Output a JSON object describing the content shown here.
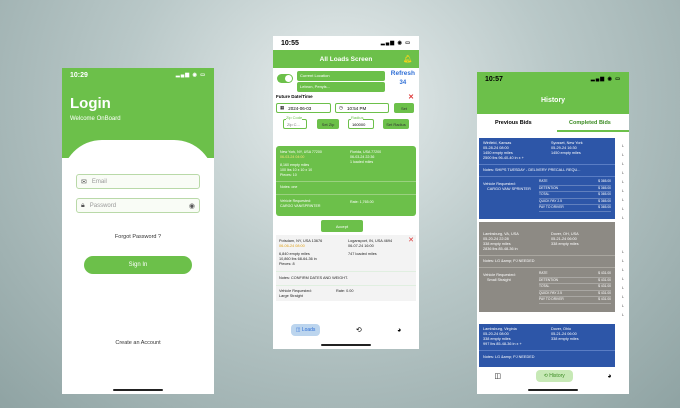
{
  "login": {
    "time": "10:29",
    "title": "Login",
    "subtitle": "Welcome OnBoard",
    "email_placeholder": "Email",
    "password_placeholder": "Password",
    "forgot": "Forgot Password ?",
    "signin": "Sign In",
    "create": "Create an Account"
  },
  "loads": {
    "time": "10:55",
    "title": "All Loads Screen",
    "current_location": "Current Location",
    "current_location_value": "Lebron, Penyls...",
    "refresh": "Refresh",
    "count": "34",
    "future_label": "Future Date/Time",
    "date": "2024-06-03",
    "time_value": "10:54 PM",
    "set": "Set",
    "zip_label": "Zip Code",
    "zip_value": "Zip C...",
    "set_zip": "Set Zip",
    "radius_label": "Radius",
    "radius_value": "160000",
    "set_radius": "Set Radius",
    "card1": {
      "origin": "New York, NY, USA 77200",
      "origin_date": "06-03-24 04:00",
      "dest": "Florida, USA 77200",
      "dest_date": "06-03-24 22:36",
      "empty": "8,160 empty miles",
      "weight": "100 lbs 10 x 10 x 10",
      "pieces": "Pieces: 10",
      "dest_loaded": "1 loaded miles",
      "notes": "Notes: one",
      "vehicle_label": "Vehicle Requested:",
      "vehicle": "CARGO VAN/SPRINTER",
      "rate": "Rate: 1,765.00"
    },
    "accept": "Accept",
    "card2": {
      "origin": "Potsdam, NY, USA 13676",
      "origin_date": "06-06-24 08:00",
      "dest": "Logansport, IN, USA 4694",
      "dest_date": "06-07-24 16:00",
      "empty": "6,840 empty miles",
      "dest_loaded": "747 loaded miles",
      "weight": "10,860 lbs 68-64-36 in",
      "pieces": "Pieces: 8",
      "notes": "Notes: CONFIRM DATES AND WEIGHT.",
      "vehicle_label": "Vehicle Requested:",
      "vehicle": "Large Straight",
      "rate": "Rate: 0.00"
    },
    "nav_loads": "Loads"
  },
  "history": {
    "time": "10:57",
    "title": "History",
    "tab_prev": "Previous Bids",
    "tab_completed": "Completed Bids",
    "card1": {
      "origin": "Winfield, Kansas",
      "origin_date": "05-28-24 08:00",
      "origin_empty": "1450 empty miles",
      "origin_weight": "2500 lbs 96-40-40 in x +",
      "dest": "Syosset, New York",
      "dest_date": "05-29-24 16:30",
      "dest_empty": "1450 empty miles",
      "notes": "Notes: SHIPS TUESDAY - DELIVERY PRECALL REQU...",
      "vehicle_label": "Vehicle Requested:",
      "vehicle": "CARGO VAN/ SPRINTER",
      "rate_rows": [
        [
          "RATE",
          "$ 365.00"
        ],
        [
          "DETENTION",
          "$ 365.00"
        ],
        [
          "TOTAL",
          "$ 365.00"
        ],
        [
          "QUICK PAY 2.5",
          "$ 365.00"
        ],
        [
          "PAY TO DRIVER",
          "$ 365.00"
        ]
      ]
    },
    "card2": {
      "origin": "Lambsburg, VA, USA",
      "origin_date": "05-20-24 22:28",
      "origin_empty": "338 empty miles",
      "origin_weight": "2836 lbs 85-48-36 in",
      "dest": "Dover, OH, USA",
      "dest_date": "05-21-24 06:00",
      "dest_empty": "338 empty miles",
      "notes": "Notes: LG &amp; PJ NEEDED",
      "vehicle_label": "Vehicle Requested:",
      "vehicle": "Small Straight",
      "rate_rows": [
        [
          "RATE",
          "$ 431.00"
        ],
        [
          "DETENTION",
          "$ 431.00"
        ],
        [
          "TOTAL",
          "$ 431.00"
        ],
        [
          "QUICK PAY 2.5",
          "$ 431.00"
        ],
        [
          "PAY TO DRIVER",
          "$ 431.00"
        ]
      ]
    },
    "card3": {
      "origin": "Lambsburg, Virginia",
      "origin_date": "05-20-24 08:00",
      "origin_empty": "338 empty miles",
      "origin_weight": "997 lbs 85-48-36 in x +",
      "dest": "Dover, Ohio",
      "dest_date": "05-21-24 06:00",
      "dest_empty": "338 empty miles",
      "notes": "Notes: LG &amp; PJ NEEDED"
    },
    "nav_history": "History"
  }
}
